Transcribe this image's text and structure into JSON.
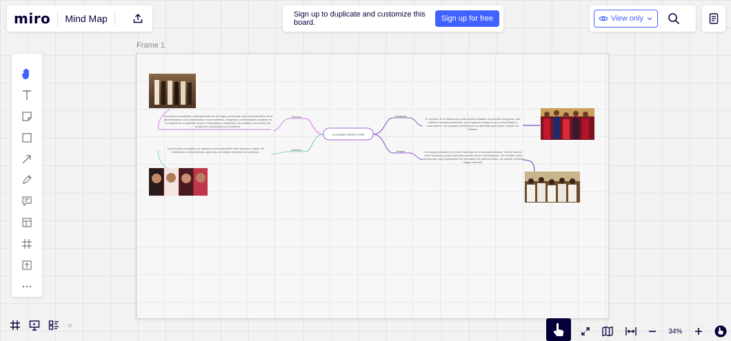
{
  "header": {
    "logo": "miro",
    "board_title": "Mind Map",
    "signup_text": "Sign up to duplicate and customize this board.",
    "signup_button": "Sign up for free",
    "view_only_label": "View only"
  },
  "toolbar": {
    "tools": [
      "hand-icon",
      "text-icon",
      "sticky-note-icon",
      "shape-icon",
      "arrow-icon",
      "pen-icon",
      "comment-icon",
      "template-icon",
      "frame-icon",
      "upload-icon",
      "more-icon"
    ]
  },
  "frame": {
    "label": "Frame 1"
  },
  "mindmap": {
    "center": "La sociedad colonial en Quito",
    "branches": [
      {
        "label": "Blancos",
        "text": "Los blancos españoles, especialmente los de origen peninsular, que eran miembros de la administración civil y eclesiástica, encomenderos, obrajeros y comerciantes, estaban en la cúspide de la pirámide social. Controlaban la audiencia, los cabildos, los centros de producción económica y el comercio."
      },
      {
        "label": "Mestizos",
        "text": "Los mestizos ocupaban un espacio social intermedio entre blancos e indios. Se dedicaban a varias labores agrícolas, al trabajo artesanal y al comercio."
      },
      {
        "label": "Indígenas",
        "text": "En la base de la estructura social colonial estaban los pueblos indígenas, que sufrieron cambios profundos, pero lograron mantener sus comunidades y costumbres. Los caciques conservaron su autoridad para hacer cumplir los tributos."
      },
      {
        "label": "Negros",
        "text": "Los negros estaban en el nivel más bajo de la sociedad colonial. Fueron traídos como esclavos y eran propiedad privada de los colonizadores. Se vendían como mercancías y los propietarios los heredaban de padres a hijos. No podían reclamar ningún derecho."
      }
    ]
  },
  "footer": {
    "collapse_label": "«",
    "zoom_level": "34%"
  },
  "colors": {
    "accent": "#4262ff",
    "dark": "#050038",
    "branch_blancos": "#d67ce6",
    "branch_mestizos": "#7fd3b0",
    "branch_indigenas": "#8f63c9",
    "branch_negros": "#8f63c9",
    "center_border": "#a06ad6"
  }
}
